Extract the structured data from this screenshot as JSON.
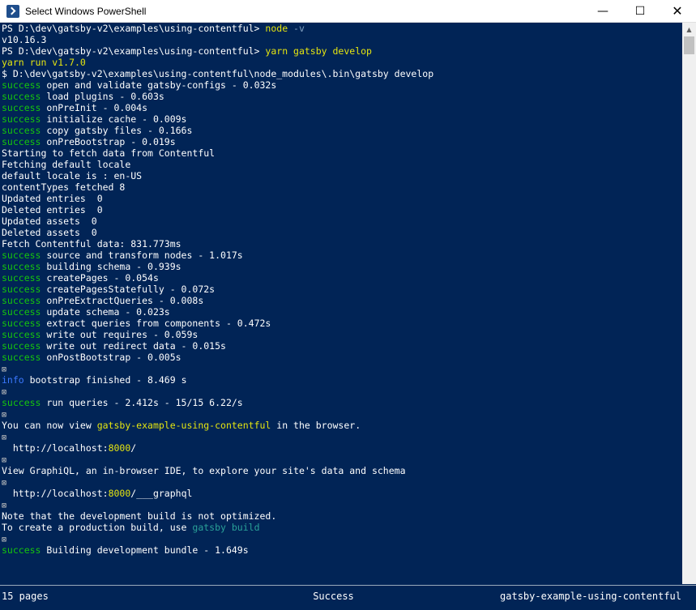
{
  "window": {
    "title": "Select Windows PowerShell",
    "minimize_glyph": "—",
    "maximize_glyph": "☐",
    "close_glyph": "✕"
  },
  "colors": {
    "console_bg": "#012456",
    "success": "#16c60c",
    "info": "#3b78ff",
    "yarn_cmd": "#e5e510"
  },
  "console": {
    "lines": [
      {
        "prefix": "PS D:\\dev\\gatsby-v2\\examples\\using-contentful> ",
        "cmd": "node",
        "arg": " -v"
      },
      {
        "text": "v10.16.3"
      },
      {
        "prefix": "PS D:\\dev\\gatsby-v2\\examples\\using-contentful> ",
        "cmd": "yarn gatsby develop"
      },
      {
        "yarn": "yarn run v1.7.0"
      },
      {
        "text": "$ D:\\dev\\gatsby-v2\\examples\\using-contentful\\node_modules\\.bin\\gatsby develop"
      },
      {
        "tag": "success",
        "text": " open and validate gatsby-configs - 0.032s"
      },
      {
        "tag": "success",
        "text": " load plugins - 0.603s"
      },
      {
        "tag": "success",
        "text": " onPreInit - 0.004s"
      },
      {
        "tag": "success",
        "text": " initialize cache - 0.009s"
      },
      {
        "tag": "success",
        "text": " copy gatsby files - 0.166s"
      },
      {
        "tag": "success",
        "text": " onPreBootstrap - 0.019s"
      },
      {
        "text": "Starting to fetch data from Contentful"
      },
      {
        "text": "Fetching default locale"
      },
      {
        "text": "default locale is : en-US"
      },
      {
        "text": "contentTypes fetched 8"
      },
      {
        "text": "Updated entries  0"
      },
      {
        "text": "Deleted entries  0"
      },
      {
        "text": "Updated assets  0"
      },
      {
        "text": "Deleted assets  0"
      },
      {
        "text": "Fetch Contentful data: 831.773ms"
      },
      {
        "tag": "success",
        "text": " source and transform nodes - 1.017s"
      },
      {
        "tag": "success",
        "text": " building schema - 0.939s"
      },
      {
        "tag": "success",
        "text": " createPages - 0.054s"
      },
      {
        "tag": "success",
        "text": " createPagesStatefully - 0.072s"
      },
      {
        "tag": "success",
        "text": " onPreExtractQueries - 0.008s"
      },
      {
        "tag": "success",
        "text": " update schema - 0.023s"
      },
      {
        "tag": "success",
        "text": " extract queries from components - 0.472s"
      },
      {
        "tag": "success",
        "text": " write out requires - 0.059s"
      },
      {
        "tag": "success",
        "text": " write out redirect data - 0.015s"
      },
      {
        "tag": "success",
        "text": " onPostBootstrap - 0.005s"
      },
      {
        "sym": "⊠"
      },
      {
        "tag": "info",
        "text": " bootstrap finished - 8.469 s"
      },
      {
        "sym": "⊠"
      },
      {
        "tag": "success",
        "text": " run queries - 2.412s - 15/15 6.22/s"
      },
      {
        "sym": "⊠"
      },
      {
        "text": "You can now view ",
        "hl": "gatsby-example-using-contentful",
        "after": " in the browser."
      },
      {
        "sym": "⊠"
      },
      {
        "text": "  http://localhost:",
        "hl": "8000",
        "after": "/"
      },
      {
        "sym": "⊠"
      },
      {
        "text": "View GraphiQL, an in-browser IDE, to explore your site's data and schema"
      },
      {
        "sym": "⊠"
      },
      {
        "text": "  http://localhost:",
        "hl": "8000",
        "after": "/___graphql"
      },
      {
        "sym": "⊠"
      },
      {
        "text": "Note that the development build is not optimized."
      },
      {
        "text": "To create a production build, use ",
        "teal": "gatsby build"
      },
      {
        "sym": "⊠"
      },
      {
        "tag": "success",
        "text": " Building development bundle - 1.649s"
      }
    ]
  },
  "status": {
    "left": "15 pages",
    "middle": "Success",
    "right": "gatsby-example-using-contentful"
  }
}
